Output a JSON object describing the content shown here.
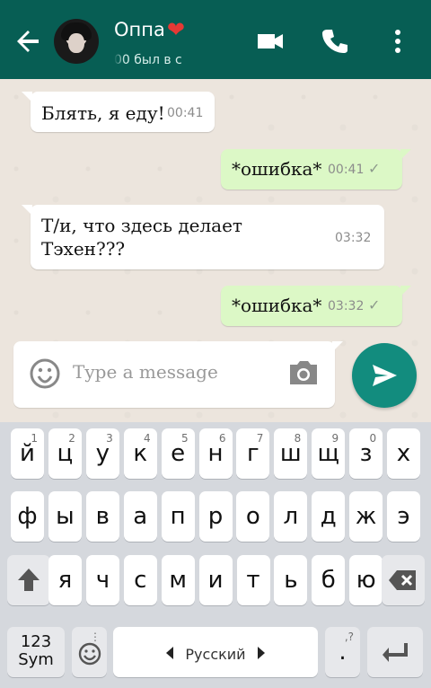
{
  "header": {
    "title": "Оппа",
    "heart_icon": "heart-icon",
    "status": "00      был в с",
    "back_icon": "arrow-back-icon",
    "video_icon": "video-camera-icon",
    "call_icon": "phone-icon",
    "menu_icon": "more-vertical-icon"
  },
  "messages": [
    {
      "text": "Блять, я еду!",
      "time": "00:41",
      "direction": "incoming"
    },
    {
      "text": "*ошибка*",
      "time": "00:41",
      "direction": "outgoing",
      "tick": "✓"
    },
    {
      "text": "Т/и, что здесь делает Тэхен???",
      "time": "03:32",
      "direction": "incoming"
    },
    {
      "text": "*ошибка*",
      "time": "03:32",
      "direction": "outgoing",
      "tick": "✓"
    }
  ],
  "composer": {
    "placeholder": "Type a message",
    "emoji_icon": "emoji-icon",
    "camera_icon": "camera-icon",
    "send_icon": "send-icon"
  },
  "keyboard": {
    "row1": [
      {
        "label": "й",
        "number": "1"
      },
      {
        "label": "ц",
        "number": "2"
      },
      {
        "label": "у",
        "number": "3"
      },
      {
        "label": "к",
        "number": "4"
      },
      {
        "label": "е",
        "number": "5"
      },
      {
        "label": "н",
        "number": "6"
      },
      {
        "label": "г",
        "number": "7"
      },
      {
        "label": "ш",
        "number": "8"
      },
      {
        "label": "щ",
        "number": "9"
      },
      {
        "label": "з",
        "number": "0"
      },
      {
        "label": "х",
        "number": ""
      }
    ],
    "row2": [
      "ф",
      "ы",
      "в",
      "а",
      "п",
      "р",
      "о",
      "л",
      "д",
      "ж",
      "э"
    ],
    "row3": [
      "я",
      "ч",
      "с",
      "м",
      "и",
      "т",
      "ь",
      "б",
      "ю"
    ],
    "symbols_label_top": "123",
    "symbols_label_bottom": "Sym",
    "space_label": "Русский",
    "punctuation_label": ".",
    "punctuation_hint": ",?",
    "shift_icon": "shift-icon",
    "backspace_icon": "backspace-icon",
    "emoji_icon": "emoji-icon",
    "enter_icon": "enter-icon"
  },
  "colors": {
    "header": "#075e54",
    "outgoing": "#dcf8c6",
    "incoming": "#ffffff",
    "accent": "#128c7e"
  }
}
